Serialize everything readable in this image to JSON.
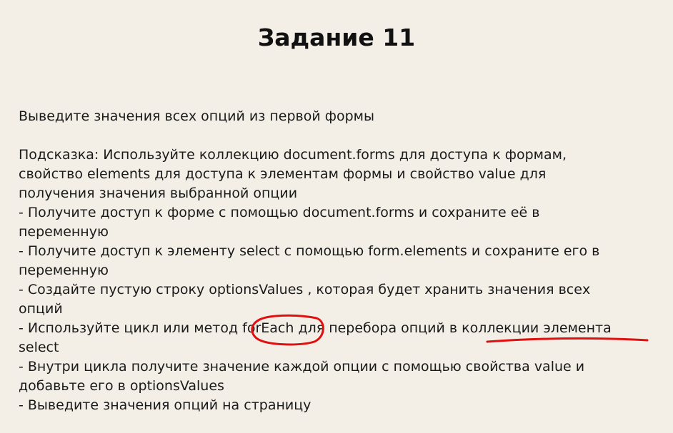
{
  "title": "Задание 11",
  "task": "Выведите значения всех опций из первой формы",
  "lines": [
    "Подсказка: Используйте коллекцию document.forms для доступа к формам,",
    "свойство elements для доступа к элементам формы и свойство value для",
    "получения значения выбранной опции",
    "- Получите доступ к форме с помощью document.forms и сохраните её в",
    "переменную",
    "- Получите доступ к элементу select с помощью form.elements и сохраните его в",
    "переменную",
    "- Создайте пустую строку optionsValues , которая будет хранить значения всех",
    "опций",
    "- Используйте цикл или метод forEach для перебора опций в коллекции элемента",
    "select",
    "- Внутри цикла получите значение каждой опции с помощью свойства value и",
    "добавьте его в optionsValues",
    "- Выведите значения опций на страницу"
  ],
  "colors": {
    "background": "#f3efe7",
    "text": "#1a1a1a",
    "annotation": "#e01010"
  }
}
